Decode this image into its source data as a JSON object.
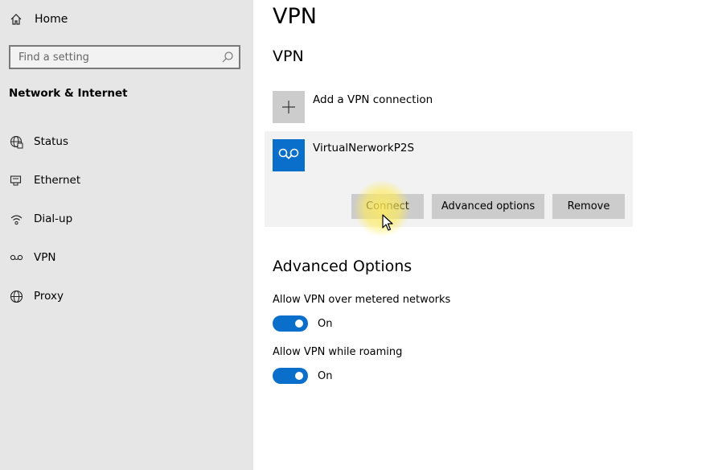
{
  "sidebar": {
    "home_label": "Home",
    "search_placeholder": "Find a setting",
    "section_title": "Network & Internet",
    "items": [
      {
        "label": "Status",
        "icon": "globe-status-icon"
      },
      {
        "label": "Ethernet",
        "icon": "ethernet-icon"
      },
      {
        "label": "Dial-up",
        "icon": "dial-up-icon"
      },
      {
        "label": "VPN",
        "icon": "vpn-icon"
      },
      {
        "label": "Proxy",
        "icon": "globe-icon"
      }
    ]
  },
  "main": {
    "page_title": "VPN",
    "section_title": "VPN",
    "add_label": "Add a VPN connection",
    "connection": {
      "name": "VirtualNerworkP2S",
      "connect_label": "Connect",
      "advanced_label": "Advanced options",
      "remove_label": "Remove"
    },
    "advanced": {
      "title": "Advanced Options",
      "options": [
        {
          "label": "Allow VPN over metered networks",
          "state": "On"
        },
        {
          "label": "Allow VPN while roaming",
          "state": "On"
        }
      ]
    }
  },
  "colors": {
    "accent": "#0a6fca",
    "sidebar_bg": "#e6e6e6",
    "card_bg": "#f2f2f2",
    "button_bg": "#cccccc",
    "highlight": "#ffec5a"
  }
}
